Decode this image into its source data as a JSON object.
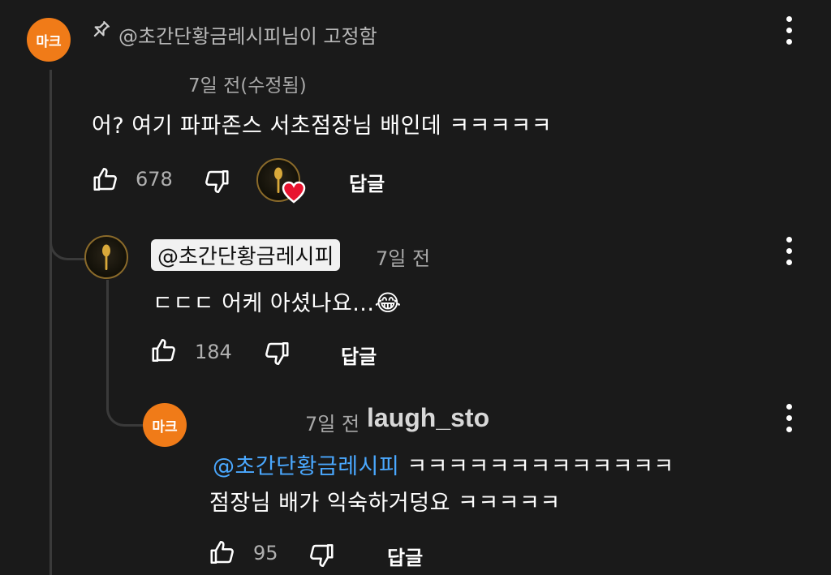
{
  "pinned": {
    "avatar_label": "마크",
    "pinned_by_text": "@초간단황금레시피님이 고정함",
    "timestamp": "7일 전(수정됨)",
    "body": "어? 여기 파파존스 서초점장님 배인데 ㅋㅋㅋㅋㅋ",
    "like_count": "678",
    "reply_label": "답글"
  },
  "reply1": {
    "author_chip": "@초간단황금레시피",
    "timestamp": "7일 전",
    "body": "ㄷㄷㄷ 어케 아셨나요...",
    "emoji": "😂",
    "like_count": "184",
    "reply_label": "답글"
  },
  "reply2": {
    "avatar_label": "마크",
    "timestamp": "7일 전",
    "watermark": "laugh_sto",
    "mention": "@초간단황금레시피",
    "line1_rest": "ㅋㅋㅋㅋㅋㅋㅋㅋㅋㅋㅋㅋㅋ",
    "line2": "점장님 배가 익숙하거덩요 ㅋㅋㅋㅋㅋ",
    "like_count": "95",
    "reply_label": "답글"
  },
  "colors": {
    "background": "#1a1a1a",
    "maker_avatar": "#f07b18",
    "mention_link": "#4aa8ff",
    "heart": "#e8132f"
  }
}
